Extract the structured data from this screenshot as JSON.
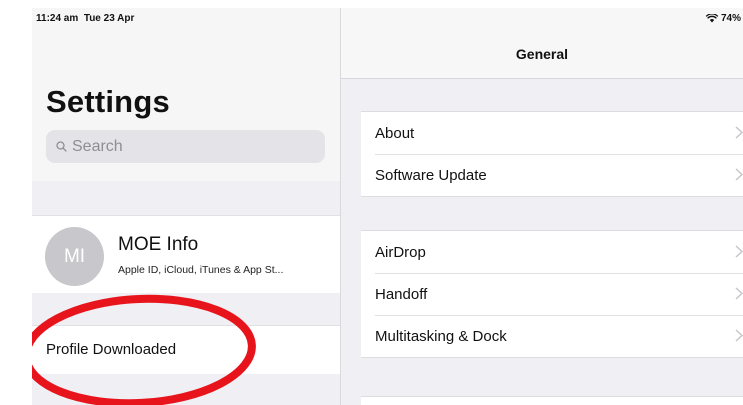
{
  "status_bar": {
    "time": "11:24 am",
    "date": "Tue 23 Apr",
    "battery": "74%",
    "wifi_icon": "wifi-icon"
  },
  "sidebar": {
    "title": "Settings",
    "search": {
      "placeholder": "Search",
      "icon": "search-icon"
    },
    "account": {
      "initials": "MI",
      "name": "MOE Info",
      "subtitle": "Apple ID, iCloud, iTunes & App St..."
    },
    "profile_label": "Profile Downloaded"
  },
  "detail": {
    "title": "General",
    "groups": [
      {
        "rows": [
          {
            "label": "About"
          },
          {
            "label": "Software Update"
          }
        ]
      },
      {
        "rows": [
          {
            "label": "AirDrop"
          },
          {
            "label": "Handoff"
          },
          {
            "label": "Multitasking & Dock"
          }
        ]
      }
    ]
  },
  "colors": {
    "highlight": "#e8141b",
    "background": "#efeff4",
    "avatar": "#c7c7cc",
    "chevron": "#c4c4c9"
  }
}
